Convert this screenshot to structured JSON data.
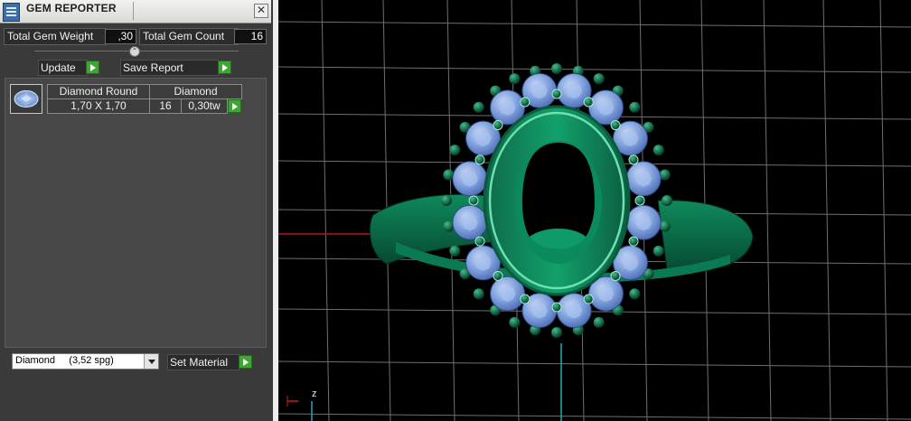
{
  "window": {
    "title": "GEM REPORTER",
    "close_glyph": "✕"
  },
  "totals": {
    "weight_label": "Total Gem Weight",
    "weight_value": ",30",
    "count_label": "Total Gem Count",
    "count_value": "16"
  },
  "buttons": {
    "update_label": "Update",
    "save_label": "Save Report",
    "set_material_label": "Set Material"
  },
  "gems": {
    "columns": [
      "Diamond Round",
      "Diamond"
    ],
    "rows": [
      {
        "cut": "Diamond Round",
        "type": "Diamond",
        "size": "1,70 X 1,70",
        "count": "16",
        "weight": "0,30tw"
      }
    ]
  },
  "material": {
    "selected": "Diamond     (3,52 spg)"
  },
  "viewport": {
    "axis_label": "z",
    "icons": [
      "gem-reporter-icon",
      "close-icon",
      "collapse-icon",
      "play-icon",
      "chevron-down-icon"
    ]
  },
  "colors": {
    "panel": "#3a3a3a",
    "metal": "#0a7a55",
    "gem": "#7d9fdc",
    "prong": "#0c5a3c",
    "grid": "#6f6f6f",
    "accent_button": "#3fa635"
  }
}
